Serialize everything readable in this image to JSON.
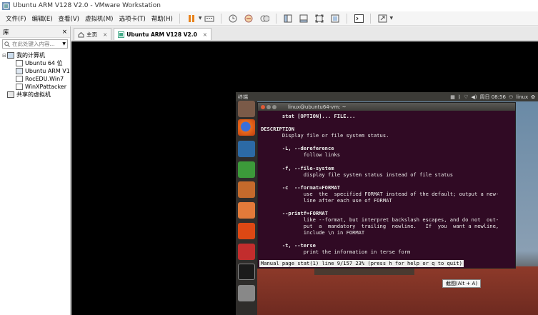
{
  "window": {
    "title": "Ubuntu ARM V128 V2.0 - VMware Workstation"
  },
  "menu": {
    "items": [
      "文件(F)",
      "编辑(E)",
      "查看(V)",
      "虚拟机(M)",
      "选项卡(T)",
      "帮助(H)"
    ]
  },
  "toolbar": {
    "icons": [
      "pause-icon",
      "send-keys-icon",
      "snapshot-icon",
      "revert-snapshot-icon",
      "manage-snapshots-icon",
      "show-library-icon",
      "thumbnail-icon",
      "full-screen-icon",
      "unity-icon",
      "console-view-icon",
      "stretch-icon"
    ]
  },
  "library": {
    "title": "库",
    "close": "×",
    "search_placeholder": "在此处键入内容...",
    "tree": [
      {
        "label": "我的计算机",
        "level": 0,
        "expanded": true,
        "icon": "computer-icon"
      },
      {
        "label": "Ubuntu 64 位",
        "level": 1,
        "icon": "vm-icon"
      },
      {
        "label": "Ubuntu ARM V1",
        "level": 1,
        "icon": "vm-running-icon"
      },
      {
        "label": "RocEDU.Win7",
        "level": 1,
        "icon": "vm-icon"
      },
      {
        "label": "WinXPattacker",
        "level": 1,
        "icon": "vm-icon"
      },
      {
        "label": "共享的虚拟机",
        "level": 0,
        "icon": "shared-vms-icon"
      }
    ]
  },
  "tabs": [
    {
      "label": "主页",
      "close": "×",
      "active": false
    },
    {
      "label": "Ubuntu ARM V128 V2.0",
      "close": "×",
      "active": true
    }
  ],
  "guest": {
    "panel_title": "终端",
    "clock": "周日 08:56",
    "user": "linux",
    "terminal": {
      "title": "linux@ubuntu64-vm: ~",
      "lines": [
        "       stat [OPTION]... FILE...",
        "",
        "DESCRIPTION",
        "       Display file or file system status.",
        "",
        "       -L, --dereference",
        "              follow links",
        "",
        "       -f, --file-system",
        "              display file system status instead of file status",
        "",
        "       -c  --format=FORMAT",
        "              use  the  specified FORMAT instead of the default; output a new-",
        "              line after each use of FORMAT",
        "",
        "       --printf=FORMAT",
        "              like --format, but interpret backslash escapes, and do not  out-",
        "              put  a  mandatory  trailing  newline.   If  you  want a newline,",
        "              include \\n in FORMAT",
        "",
        "       -t, --terse",
        "              print the information in terse form"
      ],
      "status": "Manual page stat(1) line 9/157 23% (press h for help or q to quit)"
    },
    "tooltip": "截图(Alt + A)"
  },
  "colors": {
    "terminal_bg": "#300a24",
    "launcher_bg": "#2f2d2b",
    "accent_orange": "#e95420"
  }
}
